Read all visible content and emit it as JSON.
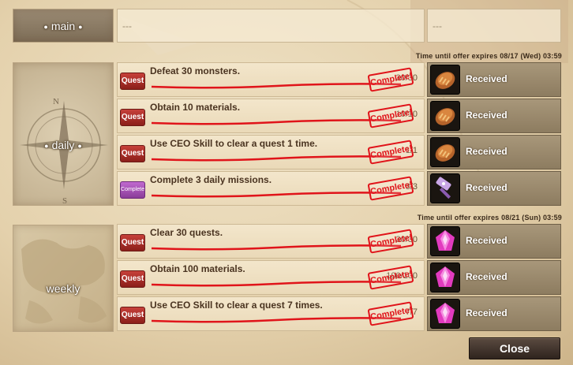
{
  "main_tab": {
    "label": "main"
  },
  "header": {
    "left_text": "---",
    "right_text": "---"
  },
  "categories": [
    {
      "label": "daily",
      "expire_text": "Time until offer expires 08/17 (Wed) 03:59",
      "quests": [
        {
          "badge": "Quest",
          "text": "Defeat 30 monsters.",
          "progress": "30/30",
          "stamp": "Complete!",
          "reward_icon": "bread-icon",
          "reward_text": "Received"
        },
        {
          "badge": "Quest",
          "text": "Obtain 10 materials.",
          "progress": "10/10",
          "stamp": "Complete!",
          "reward_icon": "bread-icon",
          "reward_text": "Received"
        },
        {
          "badge": "Quest",
          "text": "Use CEO Skill to clear a quest 1 time.",
          "progress": "1/1",
          "stamp": "Complete!",
          "reward_icon": "bread-icon",
          "reward_text": "Received"
        },
        {
          "badge": "Complete",
          "text": "Complete 3 daily missions.",
          "progress": "3/3",
          "stamp": "Complete!",
          "reward_icon": "hammer-icon",
          "reward_text": "Received"
        }
      ]
    },
    {
      "label": "weekly",
      "expire_text": "Time until offer expires 08/21 (Sun) 03:59",
      "quests": [
        {
          "badge": "Quest",
          "text": "Clear 30 quests.",
          "progress": "30/30",
          "stamp": "Complete!",
          "reward_icon": "gem-icon",
          "reward_text": "Received"
        },
        {
          "badge": "Quest",
          "text": "Obtain 100 materials.",
          "progress": "100/100",
          "stamp": "Complete!",
          "reward_icon": "gem-icon",
          "reward_text": "Received"
        },
        {
          "badge": "Quest",
          "text": "Use CEO Skill to clear a quest 7 times.",
          "progress": "7/7",
          "stamp": "Complete!",
          "reward_icon": "gem-icon",
          "reward_text": "Received"
        }
      ]
    }
  ],
  "close_button": {
    "label": "Close"
  },
  "colors": {
    "stamp_red": "#e0141a",
    "quest_badge": "#b3312b",
    "complete_badge": "#a24fb1"
  }
}
